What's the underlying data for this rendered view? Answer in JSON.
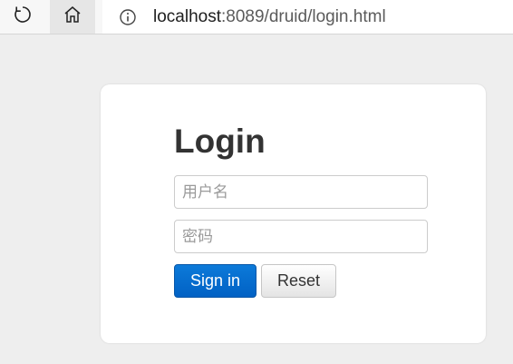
{
  "browser": {
    "url_host": "localhost",
    "url_rest": ":8089/druid/login.html",
    "icons": {
      "reload": "reload-icon",
      "home": "home-icon",
      "info": "info-icon"
    }
  },
  "login": {
    "title": "Login",
    "username_placeholder": "用户名",
    "password_placeholder": "密码",
    "signin_label": "Sign in",
    "reset_label": "Reset"
  },
  "colors": {
    "page_background": "#eeeeee",
    "card_background": "#ffffff",
    "primary_button": "#0161c4"
  }
}
